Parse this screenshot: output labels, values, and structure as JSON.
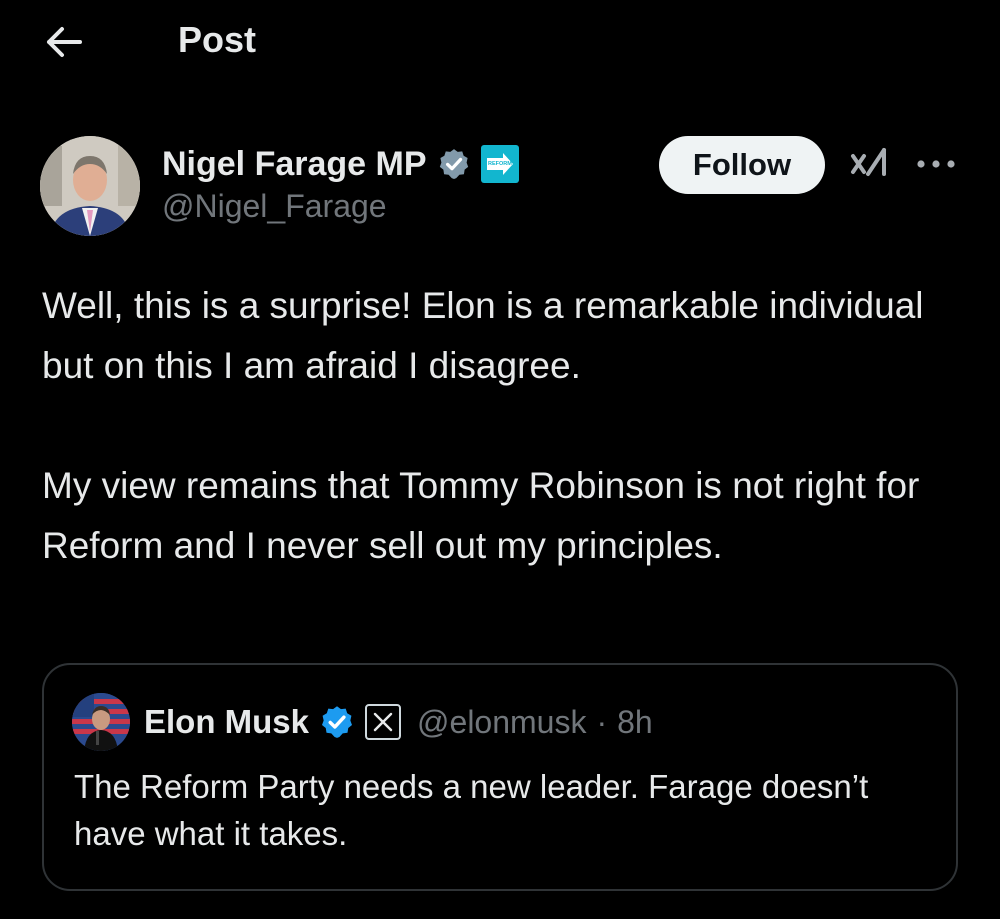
{
  "header": {
    "title": "Post",
    "back_icon": "arrow-left-icon"
  },
  "author": {
    "display_name": "Nigel Farage MP",
    "handle": "@Nigel_Farage",
    "verified_badge": "gray-verified-icon",
    "affiliation_badge": "reform-uk-badge",
    "affiliation_badge_text": "REFORM UK",
    "affiliation_color": "#12b6cf"
  },
  "actions": {
    "follow_label": "Follow",
    "grok_icon": "grok-icon",
    "more_icon": "more-horizontal-icon"
  },
  "post": {
    "paragraphs": [
      "Well, this is a surprise! Elon is a remarkable individual but on this I am afraid I disagree.",
      "My view remains that Tommy Robinson is not right for Reform and I never sell out my principles."
    ]
  },
  "quoted_post": {
    "display_name": "Elon Musk",
    "verified_badge": "blue-verified-icon",
    "affiliation_badge": "x-logo-badge",
    "handle": "@elonmusk",
    "separator": "·",
    "time": "8h",
    "text": "The Reform Party needs a new leader. Farage doesn’t have what it takes."
  },
  "colors": {
    "background": "#000000",
    "text_primary": "#e7e9ea",
    "text_secondary": "#71767b",
    "verified_blue": "#1d9bf0",
    "verified_gray": "#829aab",
    "border": "#2f3336"
  }
}
